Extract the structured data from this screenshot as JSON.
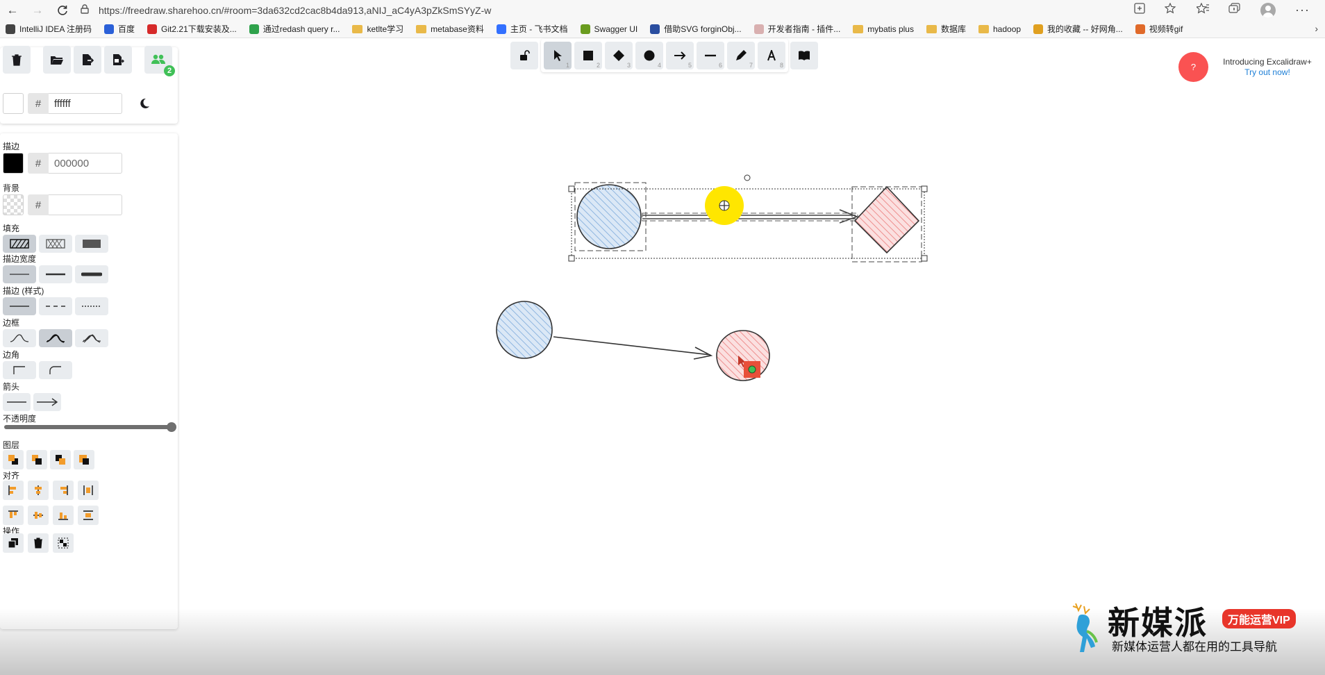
{
  "browser": {
    "url": "https://freedraw.sharehoo.cn/#room=3da632cd2cac8b4da913,aNIJ_aC4yA3pZkSmSYyZ-w"
  },
  "bookmarks": [
    {
      "label": "IntelliJ IDEA 注册码",
      "color": "#444444",
      "kind": "page"
    },
    {
      "label": "百度",
      "color": "#2b60d8",
      "kind": "page"
    },
    {
      "label": "Git2.21下载安装及...",
      "color": "#d62a2a",
      "kind": "page"
    },
    {
      "label": "通过redash query r...",
      "color": "#2fa24c",
      "kind": "page"
    },
    {
      "label": "ketlte学习",
      "color": "#e9b949",
      "kind": "folder"
    },
    {
      "label": "metabase资料",
      "color": "#e9b949",
      "kind": "folder"
    },
    {
      "label": "主页 - 飞书文档",
      "color": "#3370ff",
      "kind": "page"
    },
    {
      "label": "Swagger UI",
      "color": "#6a9c1f",
      "kind": "page"
    },
    {
      "label": "借助SVG forginObj...",
      "color": "#2a4ea0",
      "kind": "page"
    },
    {
      "label": "开发者指南 - 插件...",
      "color": "#d9b0b0",
      "kind": "page"
    },
    {
      "label": "mybatis plus",
      "color": "#e9b949",
      "kind": "folder"
    },
    {
      "label": "数据库",
      "color": "#e9b949",
      "kind": "folder"
    },
    {
      "label": "hadoop",
      "color": "#e9b949",
      "kind": "folder"
    },
    {
      "label": "我的收藏 -- 好网角...",
      "color": "#e0a020",
      "kind": "page"
    },
    {
      "label": "视频转gif",
      "color": "#e06a2a",
      "kind": "page"
    }
  ],
  "top_panel": {
    "collab_count": "2",
    "canvas_bg": {
      "hash": "#",
      "value": "ffffff"
    }
  },
  "props": {
    "stroke_label": "描边",
    "stroke_color": {
      "hash": "#",
      "value": "000000"
    },
    "bg_label": "背景",
    "bg_color": {
      "hash": "#",
      "value": ""
    },
    "fill_label": "填充",
    "stroke_width_label": "描边宽度",
    "stroke_style_label": "描边 (样式)",
    "sloppiness_label": "边框",
    "edges_label": "边角",
    "arrowhead_label": "箭头",
    "opacity_label": "不透明度",
    "opacity": 100,
    "layers_label": "图层",
    "align_label": "对齐",
    "actions_label": "操作"
  },
  "toolbar": {
    "tools": [
      {
        "name": "selection",
        "num": "1"
      },
      {
        "name": "rectangle",
        "num": "2"
      },
      {
        "name": "diamond",
        "num": "3"
      },
      {
        "name": "ellipse",
        "num": "4"
      },
      {
        "name": "arrow",
        "num": "5"
      },
      {
        "name": "line",
        "num": "6"
      },
      {
        "name": "draw",
        "num": "7"
      },
      {
        "name": "text",
        "num": "8"
      }
    ],
    "active_tool": "selection"
  },
  "help": {
    "button": "?",
    "intro_title": "Introducing Excalidraw+",
    "intro_link": "Try out now!"
  },
  "colors": {
    "blue_fill": "#a5c8ec",
    "red_fill": "#f3a6a6",
    "help_red": "#fa5252",
    "collab_green": "#40c057",
    "cursor_yellow": "#ffe600"
  },
  "watermark": {
    "title": "新媒派",
    "vip": "万能运营VIP",
    "subtitle": "新媒体运营人都在用的工具导航"
  }
}
